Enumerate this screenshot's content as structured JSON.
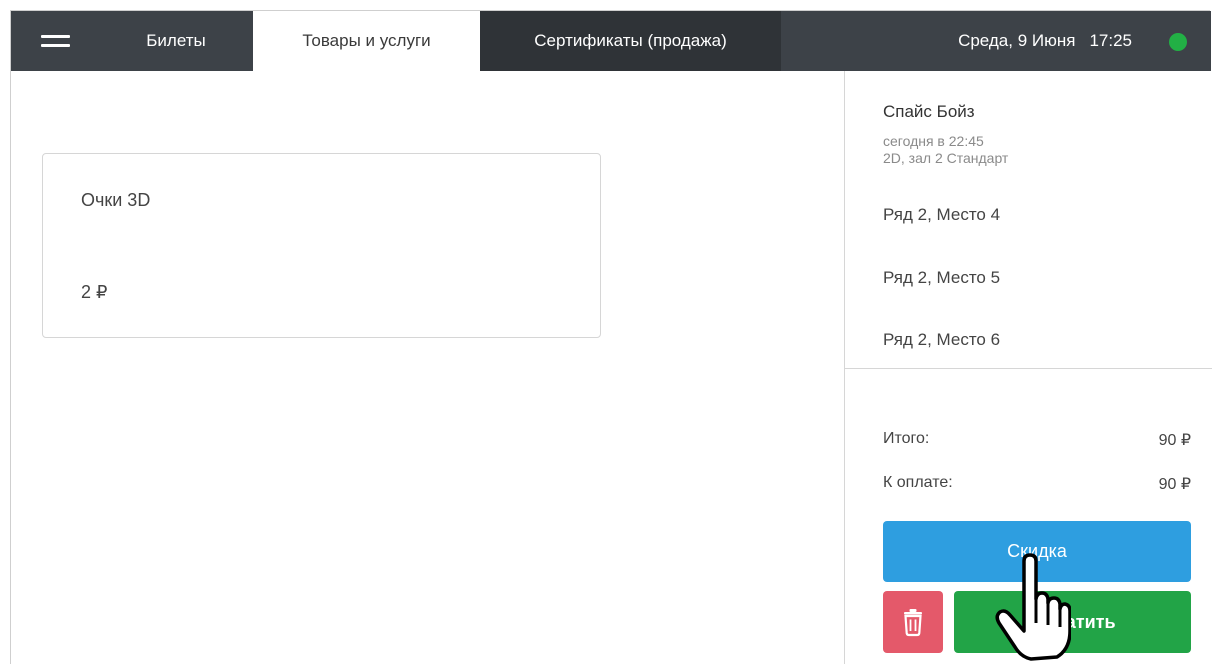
{
  "tabs": [
    {
      "label": "Билеты"
    },
    {
      "label": "Товары и услуги"
    },
    {
      "label": "Сертификаты (продажа)"
    }
  ],
  "header": {
    "date": "Среда, 9 Июня",
    "time": "17:25",
    "status_color": "#22b045"
  },
  "products": [
    {
      "name": "Очки 3D",
      "price": "2 ₽"
    }
  ],
  "order": {
    "film_title": "Спайс Бойз",
    "film_time": "сегодня в 22:45",
    "film_hall": "2D, зал 2 Стандарт",
    "seats": [
      "Ряд 2, Место 4",
      "Ряд 2, Место 5",
      "Ряд 2, Место 6"
    ],
    "total_label": "Итого:",
    "total_value": "90 ₽",
    "to_pay_label": "К оплате:",
    "to_pay_value": "90 ₽",
    "discount_label": "Скидка",
    "pay_label": "Оплатить",
    "delete_icon": "trash-icon"
  },
  "colors": {
    "topbar": "#3d4248",
    "discount": "#2e9ee0",
    "delete": "#e4596a",
    "pay": "#22a447"
  }
}
